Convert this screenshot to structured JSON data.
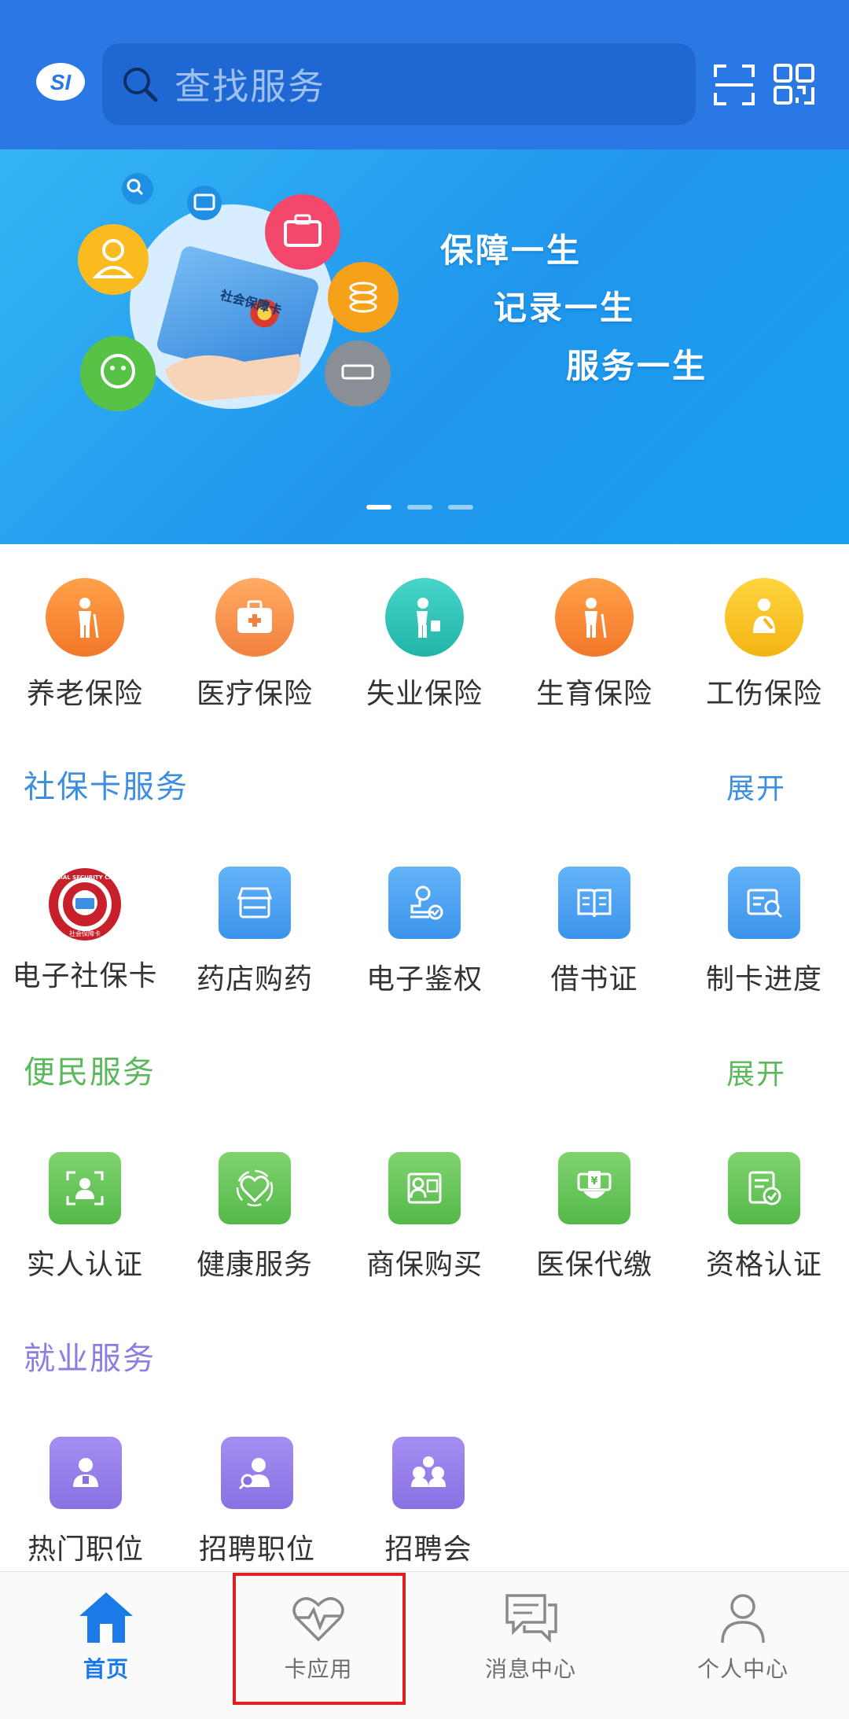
{
  "header": {
    "search_placeholder": "查找服务",
    "logo_text": "SI"
  },
  "banner": {
    "slogans": [
      "保障一生",
      "记录一生",
      "服务一生"
    ],
    "card_text": "社会保障卡",
    "active_page": 1,
    "page_count": 3
  },
  "insurance": [
    {
      "label": "养老保险",
      "color": "#f7843a",
      "icon": "elderly-icon"
    },
    {
      "label": "医疗保险",
      "color": "#f58a4b",
      "icon": "medical-kit-icon"
    },
    {
      "label": "失业保险",
      "color": "#2ec5b8",
      "icon": "job-seeker-icon"
    },
    {
      "label": "生育保险",
      "color": "#f7843a",
      "icon": "family-icon"
    },
    {
      "label": "工伤保险",
      "color": "#f6c21e",
      "icon": "injury-icon"
    }
  ],
  "social_card": {
    "title": "社保卡服务",
    "expand": "展开",
    "title_color": "#3b8ee0",
    "items": [
      {
        "label": "电子社保卡",
        "icon": "social-security-card-icon"
      },
      {
        "label": "药店购药",
        "icon": "pharmacy-icon"
      },
      {
        "label": "电子鉴权",
        "icon": "stamp-auth-icon"
      },
      {
        "label": "借书证",
        "icon": "library-card-icon"
      },
      {
        "label": "制卡进度",
        "icon": "card-progress-icon"
      }
    ],
    "seal_text": "SOCIAL SECURITY CARD",
    "seal_bottom": "社会保障卡"
  },
  "convenience": {
    "title": "便民服务",
    "expand": "展开",
    "title_color": "#5cb85c",
    "items": [
      {
        "label": "实人认证",
        "icon": "face-verify-icon"
      },
      {
        "label": "健康服务",
        "icon": "health-heart-icon"
      },
      {
        "label": "商保购买",
        "icon": "insurance-buy-icon"
      },
      {
        "label": "医保代缴",
        "icon": "payment-icon"
      },
      {
        "label": "资格认证",
        "icon": "qualification-icon"
      }
    ]
  },
  "employment": {
    "title": "就业服务",
    "title_color": "#8e7ce0",
    "items": [
      {
        "label": "热门职位",
        "icon": "hot-jobs-icon"
      },
      {
        "label": "招聘职位",
        "icon": "recruit-position-icon"
      },
      {
        "label": "招聘会",
        "icon": "job-fair-icon"
      }
    ]
  },
  "bottom_nav": [
    {
      "label": "首页",
      "icon": "home-icon",
      "active": true
    },
    {
      "label": "卡应用",
      "icon": "heart-pulse-icon",
      "active": false
    },
    {
      "label": "消息中心",
      "icon": "message-icon",
      "active": false
    },
    {
      "label": "个人中心",
      "icon": "person-icon",
      "active": false
    }
  ]
}
